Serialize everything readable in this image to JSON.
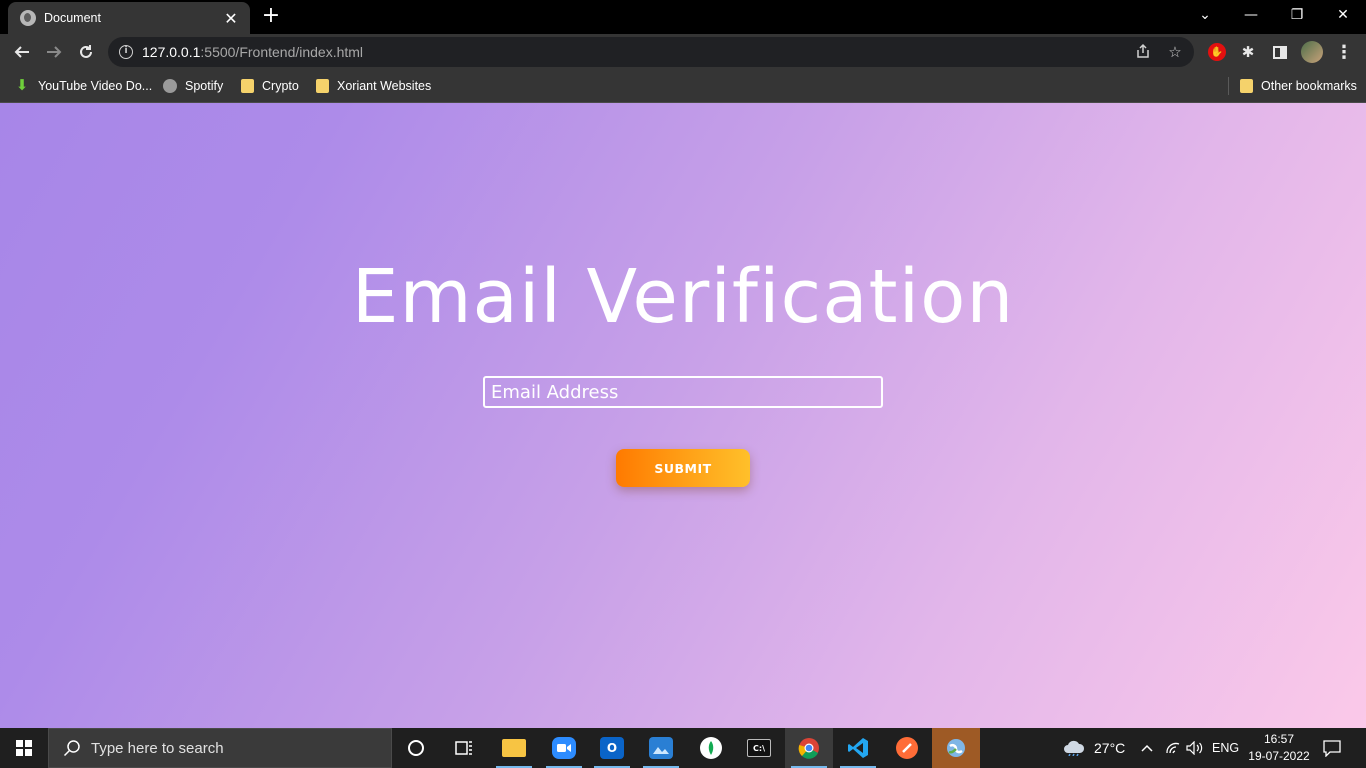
{
  "browser": {
    "tab": {
      "title": "Document",
      "close_glyph": "✕"
    },
    "new_tab_glyph": "+",
    "window_controls": {
      "dropdown": "⌄",
      "minimize": "—",
      "restore": "❐",
      "close": "✕"
    },
    "url": {
      "host": "127.0.0.1",
      "path": ":5500/Frontend/index.html"
    },
    "bookmarks": [
      {
        "label": "YouTube Video Do...",
        "icon": "download-arrow-icon"
      },
      {
        "label": "Spotify",
        "icon": "globe-icon"
      },
      {
        "label": "Crypto",
        "icon": "folder-icon"
      },
      {
        "label": "Xoriant Websites",
        "icon": "folder-icon"
      }
    ],
    "other_bookmarks": "Other bookmarks"
  },
  "page": {
    "title": "Email Verification",
    "email_placeholder": "Email Address",
    "submit_label": "SUBMIT"
  },
  "taskbar": {
    "search_placeholder": "Type here to search",
    "weather": "27°C",
    "language": "ENG",
    "time": "16:57",
    "date": "19-07-2022",
    "apps": [
      "cortana",
      "task-view",
      "file-explorer",
      "zoom",
      "outlook",
      "photos",
      "mongodb-compass",
      "terminal",
      "chrome",
      "vscode",
      "postman",
      "browser-extension-app"
    ]
  },
  "colors": {
    "gradient_start": "#a786e8",
    "gradient_end": "#fbc9e9",
    "button_start": "#ff7a00",
    "button_end": "#ffc02a"
  }
}
